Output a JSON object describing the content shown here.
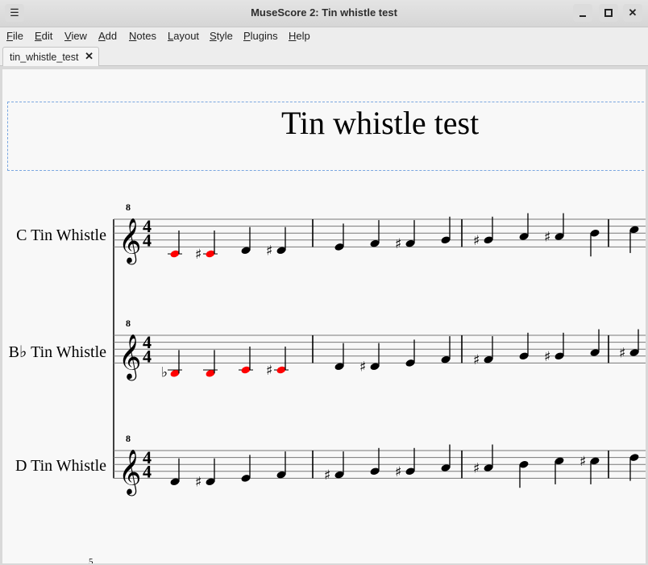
{
  "window": {
    "title": "MuseScore 2: Tin whistle test",
    "menu_icon": "hamburger-menu-icon",
    "controls": {
      "minimize": "minimize-icon",
      "maximize": "maximize-icon",
      "close": "close-icon"
    }
  },
  "menubar": {
    "items": [
      {
        "label": "File",
        "mnemonic": "F"
      },
      {
        "label": "Edit",
        "mnemonic": "E"
      },
      {
        "label": "View",
        "mnemonic": "V"
      },
      {
        "label": "Add",
        "mnemonic": "A"
      },
      {
        "label": "Notes",
        "mnemonic": "N"
      },
      {
        "label": "Layout",
        "mnemonic": "L"
      },
      {
        "label": "Style",
        "mnemonic": "S"
      },
      {
        "label": "Plugins",
        "mnemonic": "P"
      },
      {
        "label": "Help",
        "mnemonic": "H"
      }
    ]
  },
  "tabs": [
    {
      "label": "tin_whistle_test",
      "close_icon": "close-icon",
      "active": true
    }
  ],
  "score": {
    "title": "Tin whistle test",
    "time_signature": {
      "numerator": "4",
      "denominator": "4"
    },
    "clef": "treble-8va",
    "clef_octave_mark": "8",
    "page_number_partial": "5",
    "out_of_range_color": "#ff0000",
    "note_color": "#000000",
    "staves": [
      {
        "instrument": "C Tin Whistle",
        "measures": [
          [
            {
              "pitch": "C",
              "acc": "",
              "step": -2,
              "oor": true
            },
            {
              "pitch": "C#",
              "acc": "sharp",
              "step": -2,
              "oor": true
            },
            {
              "pitch": "D",
              "acc": "",
              "step": -1
            },
            {
              "pitch": "D#",
              "acc": "sharp",
              "step": -1
            }
          ],
          [
            {
              "pitch": "E",
              "acc": "",
              "step": 0
            },
            {
              "pitch": "F",
              "acc": "",
              "step": 1
            },
            {
              "pitch": "F#",
              "acc": "sharp",
              "step": 1
            },
            {
              "pitch": "G",
              "acc": "",
              "step": 2
            }
          ],
          [
            {
              "pitch": "G#",
              "acc": "sharp",
              "step": 2
            },
            {
              "pitch": "A",
              "acc": "",
              "step": 3
            },
            {
              "pitch": "A#",
              "acc": "sharp",
              "step": 3
            },
            {
              "pitch": "B",
              "acc": "",
              "step": 4
            }
          ],
          [
            {
              "pitch": "C",
              "acc": "",
              "step": 5
            }
          ]
        ]
      },
      {
        "instrument": "B♭ Tin Whistle",
        "measures": [
          [
            {
              "pitch": "Bb",
              "acc": "flat",
              "step": -3,
              "oor": true
            },
            {
              "pitch": "B",
              "acc": "",
              "step": -3,
              "oor": true
            },
            {
              "pitch": "C",
              "acc": "",
              "step": -2,
              "oor": true
            },
            {
              "pitch": "C#",
              "acc": "sharp",
              "step": -2,
              "oor": true
            }
          ],
          [
            {
              "pitch": "D",
              "acc": "",
              "step": -1
            },
            {
              "pitch": "D#",
              "acc": "sharp",
              "step": -1
            },
            {
              "pitch": "E",
              "acc": "",
              "step": 0
            },
            {
              "pitch": "F",
              "acc": "",
              "step": 1
            }
          ],
          [
            {
              "pitch": "F#",
              "acc": "sharp",
              "step": 1
            },
            {
              "pitch": "G",
              "acc": "",
              "step": 2
            },
            {
              "pitch": "G#",
              "acc": "sharp",
              "step": 2
            },
            {
              "pitch": "A",
              "acc": "",
              "step": 3
            }
          ],
          [
            {
              "pitch": "A#",
              "acc": "sharp",
              "step": 3
            }
          ]
        ]
      },
      {
        "instrument": "D Tin Whistle",
        "measures": [
          [
            {
              "pitch": "D",
              "acc": "",
              "step": -1
            },
            {
              "pitch": "D#",
              "acc": "sharp",
              "step": -1
            },
            {
              "pitch": "E",
              "acc": "",
              "step": 0
            },
            {
              "pitch": "F",
              "acc": "",
              "step": 1
            }
          ],
          [
            {
              "pitch": "F#",
              "acc": "sharp",
              "step": 1
            },
            {
              "pitch": "G",
              "acc": "",
              "step": 2
            },
            {
              "pitch": "G#",
              "acc": "sharp",
              "step": 2
            },
            {
              "pitch": "A",
              "acc": "",
              "step": 3
            }
          ],
          [
            {
              "pitch": "A#",
              "acc": "sharp",
              "step": 3
            },
            {
              "pitch": "B",
              "acc": "",
              "step": 4
            },
            {
              "pitch": "C",
              "acc": "",
              "step": 5
            },
            {
              "pitch": "C#",
              "acc": "sharp",
              "step": 5
            }
          ],
          [
            {
              "pitch": "D",
              "acc": "",
              "step": 6
            }
          ]
        ]
      }
    ]
  }
}
